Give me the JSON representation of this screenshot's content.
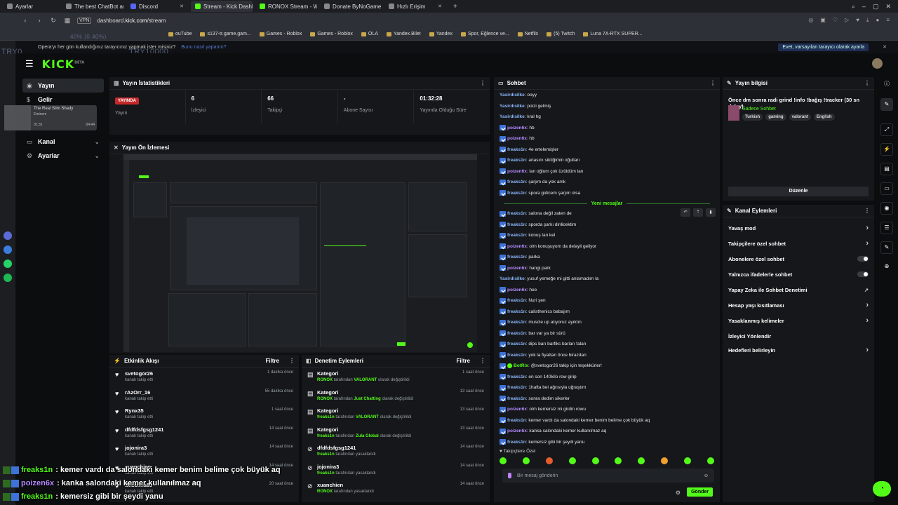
{
  "browser": {
    "tabs": [
      {
        "label": "Ayarlar",
        "active": false
      },
      {
        "label": "The best ChatBot and Wi...",
        "active": false
      },
      {
        "label": "Discord",
        "active": false
      },
      {
        "label": "Stream - Kick Dashboard",
        "active": true
      },
      {
        "label": "RONOX Stream - Watch Li...",
        "active": false
      },
      {
        "label": "Donate ByNoGame - YUS...",
        "active": false
      },
      {
        "label": "Hızlı Erişim",
        "active": false
      }
    ],
    "vpn": "VPN",
    "url_prefix": "dashboard.",
    "url_domain": "kick.com",
    "url_path": "/stream",
    "bookmarks": [
      "ouTube",
      "s137-tr.game.gam...",
      "Games - Roblox",
      "Games - Roblox",
      "OLA",
      "Yandex.Bilet",
      "Yandex",
      "Spor, Eğlence ve...",
      "Netflix",
      "(5) Twitch",
      "Luna 7A-RTX SUPER..."
    ],
    "notification": "Opera'yı her gün kullandığınız tarayıcınız yapmak ister misiniz?",
    "notification_link": "Bunu nasıl yaparım?",
    "notification_button": "Evet, varsayılan tarayıcı olarak ayarla",
    "overlay_try_1": "TRY0",
    "overlay_try_2": "TRY10000",
    "overlay_zoom": "40% (0.40%)"
  },
  "brand": {
    "logo": "KICK",
    "logo_sup": "BETA",
    "accent": "#53fc18"
  },
  "sidenav": [
    {
      "label": "Yayın",
      "icon": "broadcast-icon",
      "active": true
    },
    {
      "label": "Gelir",
      "icon": "money-icon",
      "active": false
    },
    {
      "label": "Kanal",
      "icon": "channel-icon",
      "active": false
    },
    {
      "label": "Ayarlar",
      "icon": "settings-icon",
      "active": false
    }
  ],
  "miniplayer": {
    "title": "The Real Slim Shady",
    "artist": "Eminem",
    "time": "01:31",
    "duration": "04:44"
  },
  "stats": {
    "title": "Yayın İstatistikleri",
    "items": [
      {
        "value": "YAYINDA",
        "label": "Yayın"
      },
      {
        "value": "6",
        "label": "İzleyici"
      },
      {
        "value": "66",
        "label": "Takipçi"
      },
      {
        "value": "-",
        "label": "Abone Sayısı"
      },
      {
        "value": "01:32:28",
        "label": "Yayında Olduğu Süre"
      }
    ]
  },
  "preview": {
    "title": "Yayın Ön İzlemesi"
  },
  "activity": {
    "title": "Etkinlik Akışı",
    "filter": "Filtre",
    "items": [
      {
        "name": "svetogor26",
        "sub": "kanalı takip etti",
        "time": "1 dakika önce"
      },
      {
        "name": "rAzOrr_16",
        "sub": "kanalı takip etti",
        "time": "55 dakika önce"
      },
      {
        "name": "Rynx35",
        "sub": "kanalı takip etti",
        "time": "1 saat önce"
      },
      {
        "name": "dfdfdsfgsg1241",
        "sub": "kanalı takip etti",
        "time": "14 saat önce"
      },
      {
        "name": "jojonira3",
        "sub": "kanalı takip etti",
        "time": "14 saat önce"
      },
      {
        "name": "xuanchien",
        "sub": "kanalı takip etti",
        "time": "14 saat önce"
      },
      {
        "name": "dedolina89",
        "sub": "kanalı takip etti",
        "time": "20 saat önce"
      }
    ]
  },
  "moderation": {
    "title": "Denetim Eylemleri",
    "filter": "Filtre",
    "items": [
      {
        "name": "Kategori",
        "actor": "RONOX",
        "mid": " tarafından ",
        "value": "VALORANT",
        "tail": " olarak değiştirildi",
        "time": "1 saat önce",
        "icon": "calendar-icon"
      },
      {
        "name": "Kategori",
        "actor": "RONOX",
        "mid": " tarafından ",
        "value": "Just Chatting",
        "tail": " olarak değiştirildi",
        "time": "13 saat önce",
        "icon": "calendar-icon"
      },
      {
        "name": "Kategori",
        "actor": "freaks1n",
        "mid": " tarafından ",
        "value": "VALORANT",
        "tail": " olarak değiştirildi",
        "time": "13 saat önce",
        "icon": "calendar-icon"
      },
      {
        "name": "Kategori",
        "actor": "freaks1n",
        "mid": " tarafından ",
        "value": "Zula Global",
        "tail": " olarak değiştirildi",
        "time": "13 saat önce",
        "icon": "calendar-icon"
      },
      {
        "name": "dfdfdsfgsg1241",
        "actor": "freaks1n",
        "mid": " tarafından yasaklandı",
        "value": "",
        "tail": "",
        "time": "14 saat önce",
        "icon": "ban-icon"
      },
      {
        "name": "jojonira3",
        "actor": "freaks1n",
        "mid": " tarafından yasaklandı",
        "value": "",
        "tail": "",
        "time": "14 saat önce",
        "icon": "ban-icon"
      },
      {
        "name": "xuanchien",
        "actor": "RONOX",
        "mid": " tarafından yasaklandı",
        "value": "",
        "tail": "",
        "time": "14 saat önce",
        "icon": "ban-icon"
      }
    ]
  },
  "chat": {
    "title": "Sohbet",
    "messages": [
      {
        "user": "Yasirdisilke",
        "text": ": ooyy",
        "color": "#8ab4f8",
        "badge": ""
      },
      {
        "user": "Yasirdisilke",
        "text": ": poizi gelmiş",
        "color": "#8ab4f8",
        "badge": ""
      },
      {
        "user": "Yasirdisilke",
        "text": ": kral hg",
        "color": "#8ab4f8",
        "badge": ""
      },
      {
        "user": "poizen6x",
        "text": ": hb",
        "color": "#b589ff",
        "badge": "k"
      },
      {
        "user": "poizen6x",
        "text": ": hb",
        "color": "#b589ff",
        "badge": "k"
      },
      {
        "user": "freaks1n",
        "text": ": 4e ertelemişler",
        "color": "#8ab4f8",
        "badge": "k"
      },
      {
        "user": "freaks1n",
        "text": ": anasını siktiğimin oğulları",
        "color": "#8ab4f8",
        "badge": "k"
      },
      {
        "user": "poizen6x",
        "text": ": lan oğlum çok üzüldüm lan",
        "color": "#b589ff",
        "badge": "k"
      },
      {
        "user": "freaks1n",
        "text": ": şarjım da yok amk",
        "color": "#8ab4f8",
        "badge": "k"
      },
      {
        "user": "freaks1n",
        "text": ": spora gidicem şarjım olsa",
        "color": "#8ab4f8",
        "badge": "k"
      }
    ],
    "new_messages": "Yeni mesajlar",
    "messages2": [
      {
        "user": "freaks1n",
        "text": ": salona değil zaten de",
        "color": "#8ab4f8",
        "badge": "k"
      },
      {
        "user": "freaks1n",
        "text": ": sporda şarkı dinlicektim",
        "color": "#8ab4f8",
        "badge": "k"
      },
      {
        "user": "freaks1n",
        "text": ": konuş lan kel",
        "color": "#8ab4f8",
        "badge": "k"
      },
      {
        "user": "poizen6x",
        "text": ": olm konuşuyom da delayli geliyor",
        "color": "#b589ff",
        "badge": "k"
      },
      {
        "user": "freaks1n",
        "text": ": parka",
        "color": "#8ab4f8",
        "badge": "k"
      },
      {
        "user": "poizen6x",
        "text": ": hangi park",
        "color": "#b589ff",
        "badge": "k"
      },
      {
        "user": "Yasirdisilke",
        "text": ": yusuf yemeğe mi gitti anlamadım la",
        "color": "#8ab4f8",
        "badge": ""
      },
      {
        "user": "poizen6x",
        "text": ": hee",
        "color": "#b589ff",
        "badge": "k"
      },
      {
        "user": "freaks1n",
        "text": ": Nuri şen",
        "color": "#8ab4f8",
        "badge": "k"
      },
      {
        "user": "freaks1n",
        "text": ": calisthenics babajım",
        "color": "#8ab4f8",
        "badge": "k"
      },
      {
        "user": "freaks1n",
        "text": ": muscle up atıyoruz ayıktın",
        "color": "#8ab4f8",
        "badge": "k"
      },
      {
        "user": "freaks1n",
        "text": ": bar var ya bir sürü",
        "color": "#8ab4f8",
        "badge": "k"
      },
      {
        "user": "freaks1n",
        "text": ": dips barı barfiks barları falan",
        "color": "#8ab4f8",
        "badge": "k"
      },
      {
        "user": "freaks1n",
        "text": ": yok la fiyattan önce birazdan",
        "color": "#8ab4f8",
        "badge": "k"
      },
      {
        "user": "BotRix",
        "text": ": @svetogor26 takip için teşekkürler!",
        "color": "#53fc18",
        "badge": "kg"
      },
      {
        "user": "freaks1n",
        "text": ": en son 140kilo row girip",
        "color": "#8ab4f8",
        "badge": "k"
      },
      {
        "user": "freaks1n",
        "text": ": 1hafta bel ağrısıyla uğraştım",
        "color": "#8ab4f8",
        "badge": "k"
      },
      {
        "user": "freaks1n",
        "text": ": sonra dedim sikerler",
        "color": "#8ab4f8",
        "badge": "k"
      },
      {
        "user": "poizen6x",
        "text": ": olm kemersiz mi girdin rowu",
        "color": "#b589ff",
        "badge": "k"
      },
      {
        "user": "freaks1n",
        "text": ": kemer vardı da salondaki kemer benim belime çok büyük aq",
        "color": "#8ab4f8",
        "badge": "k"
      },
      {
        "user": "poizen6x",
        "text": ": kanka salondaki kemer kullanılmaz aq",
        "color": "#b589ff",
        "badge": "k"
      },
      {
        "user": "freaks1n",
        "text": ": kemersiz gibi bir şeydi yanu",
        "color": "#8ab4f8",
        "badge": "k"
      }
    ],
    "followers_only": "Takipçilere Özel",
    "placeholder": "Bir mesaj gönderin",
    "send": "Gönder"
  },
  "stream_info": {
    "title": "Yayın bilgisi",
    "stream_title": "Önce dm sonra radi grind !info !bağış !tracker (30 sn delay)",
    "category": "Sadece Sohbet",
    "tags": [
      "Turkish",
      "gaming",
      "valorant",
      "English"
    ],
    "edit": "Düzenle"
  },
  "channel_actions": {
    "title": "Kanal Eylemleri",
    "items": [
      {
        "label": "Yavaş mod",
        "control": "chevron"
      },
      {
        "label": "Takipçilere özel sohbet",
        "control": "chevron"
      },
      {
        "label": "Abonelere özel sohbet",
        "control": "toggle"
      },
      {
        "label": "Yalnızca ifadelerle sohbet",
        "control": "toggle"
      },
      {
        "label": "Yapay Zeka ile Sohbet Denetimi",
        "control": "external"
      },
      {
        "label": "Hesap yaşı kısıtlaması",
        "control": "chevron"
      },
      {
        "label": "Yasaklanmış kelimeler",
        "control": "chevron"
      },
      {
        "label": "İzleyici Yönlendir",
        "control": "none"
      },
      {
        "label": "Hedefleri belirleyin",
        "control": "chevron"
      }
    ]
  },
  "overlay_chat": [
    {
      "user": "freaks1n",
      "text": ": kemer vardı da salondaki kemer benim belime çok büyük aq",
      "color": "#53fc18"
    },
    {
      "user": "poizen6x",
      "text": ": kanka salondaki kemer kullanılmaz aq",
      "color": "#b589ff"
    },
    {
      "user": "freaks1n",
      "text": ": kemersiz gibi bir şeydi yanu",
      "color": "#53fc18"
    }
  ]
}
